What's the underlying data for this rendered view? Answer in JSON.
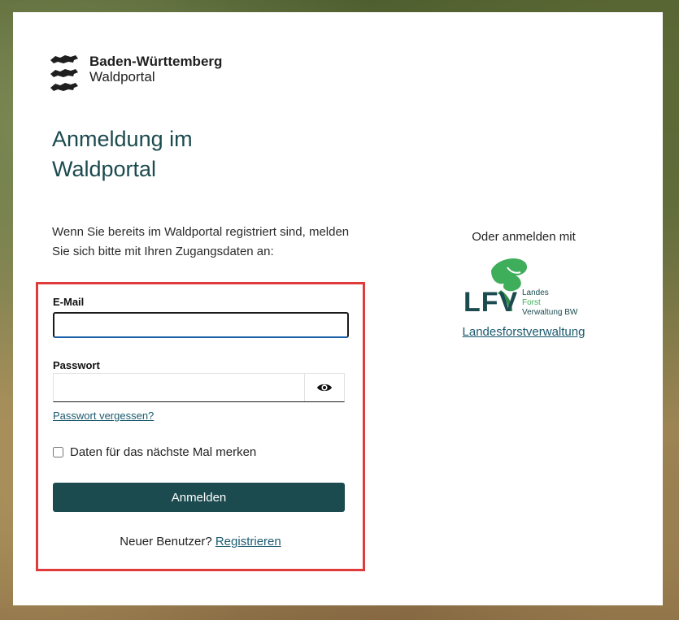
{
  "brand": {
    "line1": "Baden-Württemberg",
    "line2": "Waldportal"
  },
  "page": {
    "title": "Anmeldung im Waldportal",
    "intro": "Wenn Sie bereits im Waldportal registriert sind, melden Sie sich bitte mit Ihren Zugangsdaten an:"
  },
  "form": {
    "email_label": "E-Mail",
    "email_value": "",
    "password_label": "Passwort",
    "password_value": "",
    "forgot_link": "Passwort vergessen?",
    "remember_label": "Daten für das nächste Mal merken",
    "remember_checked": false,
    "submit_label": "Anmelden",
    "new_user_text": "Neuer Benutzer?",
    "register_link": "Registrieren"
  },
  "alt_login": {
    "heading": "Oder anmelden mit",
    "provider_logo": {
      "letters": "LFV",
      "line1": "Landes",
      "line2": "Forst",
      "line3": "Verwaltung BW"
    },
    "provider_link": "Landesforstverwaltung"
  },
  "colors": {
    "primary": "#1b4a4f",
    "highlight_border": "#e03a3a",
    "link": "#1b5a6e",
    "lfv_green": "#3fae5a"
  }
}
